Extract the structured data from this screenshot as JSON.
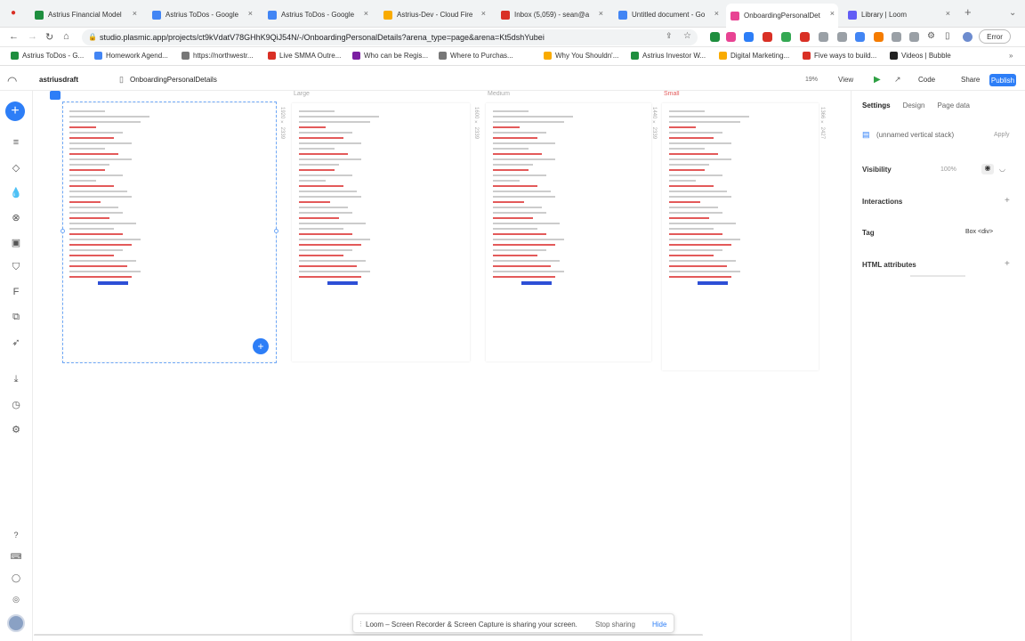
{
  "browser": {
    "tabs": [
      {
        "title": "Astrius Financial Model",
        "color": "#1e8e3e"
      },
      {
        "title": "Astrius ToDos - Google",
        "color": "#4285f4"
      },
      {
        "title": "Astrius ToDos - Google",
        "color": "#4285f4"
      },
      {
        "title": "Astrius-Dev - Cloud Fire",
        "color": "#f9ab00"
      },
      {
        "title": "Inbox (5,059) - sean@a",
        "color": "#d93025"
      },
      {
        "title": "Untitled document - Go",
        "color": "#4285f4"
      },
      {
        "title": "OnboardingPersonalDet",
        "color": "#e84393"
      },
      {
        "title": "Library | Loom",
        "color": "#625df5"
      }
    ],
    "url": "studio.plasmic.app/projects/ct9kVdatV78GHhK9QiJ54N/-/OnboardingPersonalDetails?arena_type=page&arena=Kt5dshYubei",
    "error_label": "Error",
    "bookmarks": [
      {
        "label": "Astrius ToDos - G...",
        "color": "#1e8e3e"
      },
      {
        "label": "Homework Agend...",
        "color": "#4285f4"
      },
      {
        "label": "https://northwestr...",
        "color": "#777777"
      },
      {
        "label": "Live SMMA Outre...",
        "color": "#d93025"
      },
      {
        "label": "Who can be Regis...",
        "color": "#7b1fa2"
      },
      {
        "label": "Where to Purchas...",
        "color": "#777777"
      },
      {
        "label": "Why You Shouldn'...",
        "color": "#f9ab00"
      },
      {
        "label": "Astrius Investor W...",
        "color": "#1e8e3e"
      },
      {
        "label": "Digital Marketing...",
        "color": "#f9ab00"
      },
      {
        "label": "Five ways to build...",
        "color": "#d93025"
      },
      {
        "label": "Videos | Bubble",
        "color": "#222222"
      }
    ]
  },
  "app": {
    "project_name": "astriusdraft",
    "page_name": "OnboardingPersonalDetails",
    "zoom": "19%",
    "view_label": "View",
    "code_label": "Code",
    "share_label": "Share",
    "publish_label": "Publish"
  },
  "canvas": {
    "frames": [
      {
        "label": "",
        "size": "1920 × 2339"
      },
      {
        "label": "Large",
        "size": "1600 × 2339"
      },
      {
        "label": "Medium",
        "size": "1440 × 2339"
      },
      {
        "label": "Small",
        "size": "1366 × 2427"
      }
    ]
  },
  "right_panel": {
    "tabs": [
      "Settings",
      "Design",
      "Page data"
    ],
    "element_name": "(unnamed vertical stack)",
    "apply_label": "Apply",
    "visibility_label": "Visibility",
    "visibility_value": "100%",
    "interactions_label": "Interactions",
    "tag_label": "Tag",
    "tag_value": "Box <div>",
    "html_attributes_label": "HTML attributes"
  },
  "loom_bar": {
    "message": "Loom – Screen Recorder & Screen Capture is sharing your screen.",
    "stop_label": "Stop sharing",
    "hide_label": "Hide"
  }
}
